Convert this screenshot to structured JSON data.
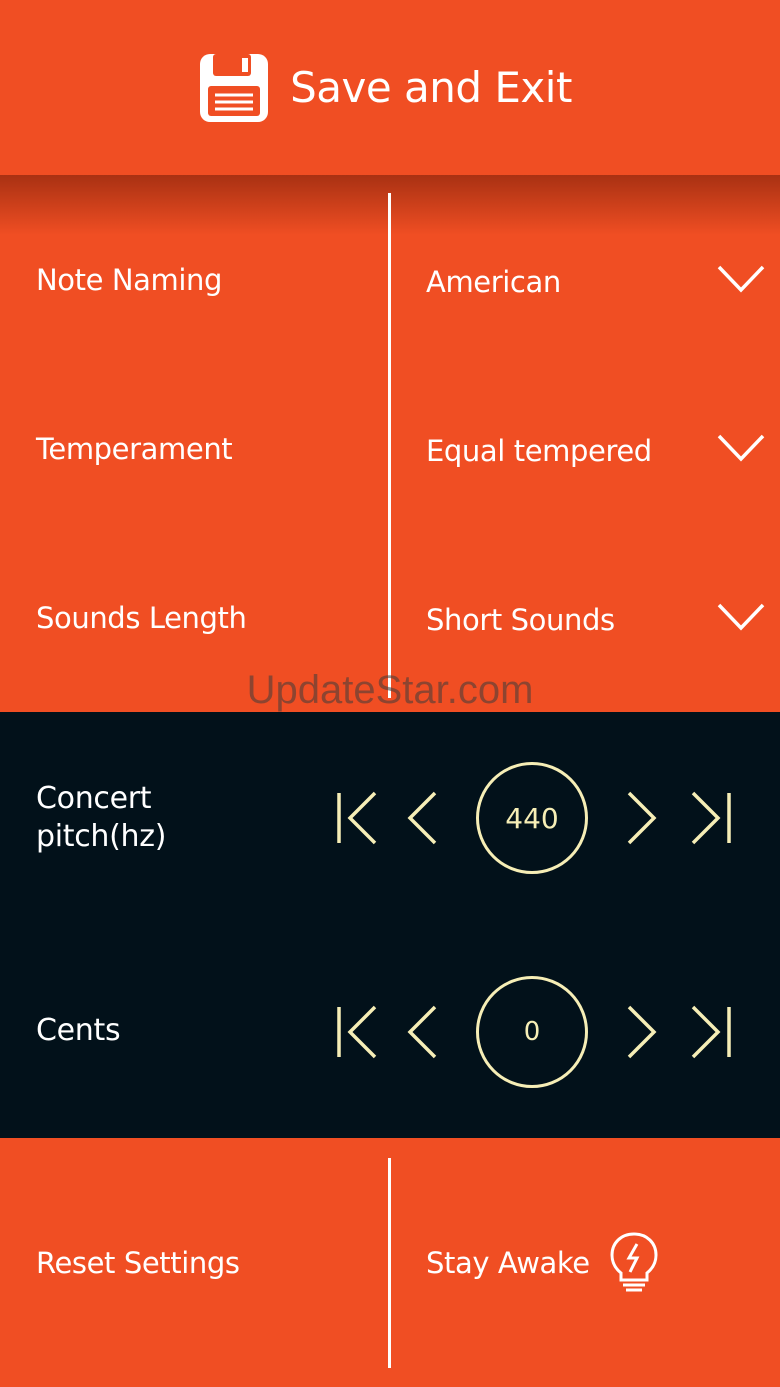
{
  "header": {
    "title": "Save and Exit",
    "icon": "floppy-disk-icon"
  },
  "settings": [
    {
      "label": "Note Naming",
      "value": "American",
      "icon": "chevron-down-icon"
    },
    {
      "label": "Temperament",
      "value": "Equal tempered",
      "icon": "chevron-down-icon"
    },
    {
      "label": "Sounds Length",
      "value": "Short Sounds",
      "icon": "chevron-down-icon"
    }
  ],
  "watermark": "UpdateStar.com",
  "controls": [
    {
      "label_line1": "Concert",
      "label_line2": "pitch(hz)",
      "value": "440"
    },
    {
      "label": "Cents",
      "value": "0"
    }
  ],
  "footer": {
    "reset_label": "Reset Settings",
    "awake_label": "Stay Awake",
    "awake_icon": "lightbulb-bolt-icon"
  },
  "colors": {
    "accent": "#f04e23",
    "dark_panel": "#02111a",
    "control_stroke": "#f6eeb6",
    "text": "#ffffff"
  }
}
